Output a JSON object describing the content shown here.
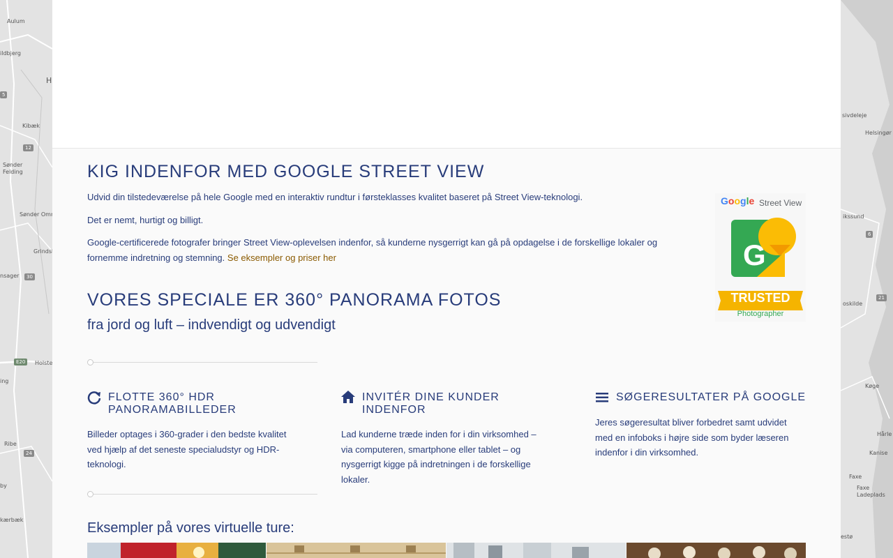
{
  "map": {
    "labels_left": [
      "Aulum",
      "ildbjerg",
      "Kibæk",
      "Sønder",
      "Felding",
      "Sønder Omme",
      "Grindsted",
      "nsager",
      "Holsted",
      "ing",
      "Ribe",
      "by",
      "kærbæk"
    ],
    "labels_right": [
      "Helsingør",
      "sivdeleje",
      "ikssund",
      "oskilde",
      "Køge",
      "Hårle",
      "Kanise",
      "Faxe",
      "Faxe Ladeplads",
      "estø"
    ],
    "road_numbers_left": [
      "12",
      "30",
      "E20",
      "24",
      "5"
    ],
    "road_numbers_right": [
      "6",
      "21"
    ],
    "road_letter": "H"
  },
  "intro": {
    "title": "KIG INDENFOR MED GOOGLE STREET VIEW",
    "p1": "Udvid din tilstedeværelse på hele Google med en interaktiv rundtur i førsteklasses kvalitet baseret på Street View-teknologi.",
    "p2": "Det er nemt, hurtigt og billigt.",
    "p3_line1": "Google-certificerede fotografer bringer Street View-oplevelsen indenfor, så kunderne nysgerrigt kan gå på opdagelse i de forskellige lokaler og",
    "p3_line2": "fornemme indretning og stemning.",
    "link": "Se eksempler og priser her"
  },
  "badge": {
    "google": "Google",
    "streetview": "Street View",
    "trusted": "TRUSTED",
    "photographer": "Photographer"
  },
  "speciale": {
    "title": "VORES SPECIALE ER 360° PANORAMA FOTOS",
    "subtitle": "fra jord og luft – indvendigt og udvendigt"
  },
  "features": [
    {
      "icon": "refresh-icon",
      "heading1": "FLOTTE 360° HDR",
      "heading2": "PANORAMABILLEDER",
      "text1": "Billeder optages i 360-grader i den bedste kvalitet",
      "text2": "ved hjælp af det seneste specialudstyr og HDR-",
      "text3": "teknologi."
    },
    {
      "icon": "home-icon",
      "heading1": "INVITÉR DINE KUNDER",
      "heading2": "INDENFOR",
      "text1": "Lad kunderne træde inden for i din virksomhed –",
      "text2": "via computeren, smartphone eller tablet – og",
      "text3": "nysgerrigt kigge på indretningen i de forskellige",
      "text4": "lokaler."
    },
    {
      "icon": "menu-icon",
      "heading1": "SØGERESULTATER PÅ GOOGLE",
      "text1": "Jeres søgeresultat bliver forbedret samt udvidet",
      "text2": "med en infoboks i højre side som byder læseren",
      "text3": "indenfor i din virksomhed."
    }
  ],
  "examples": {
    "title": "Eksempler på vores virtuelle ture:"
  },
  "colors": {
    "navy": "#283c7a",
    "link": "#8a5a00",
    "google_green": "#34a853",
    "google_yellow": "#fbbc05",
    "trusted_gold": "#f5b400"
  }
}
